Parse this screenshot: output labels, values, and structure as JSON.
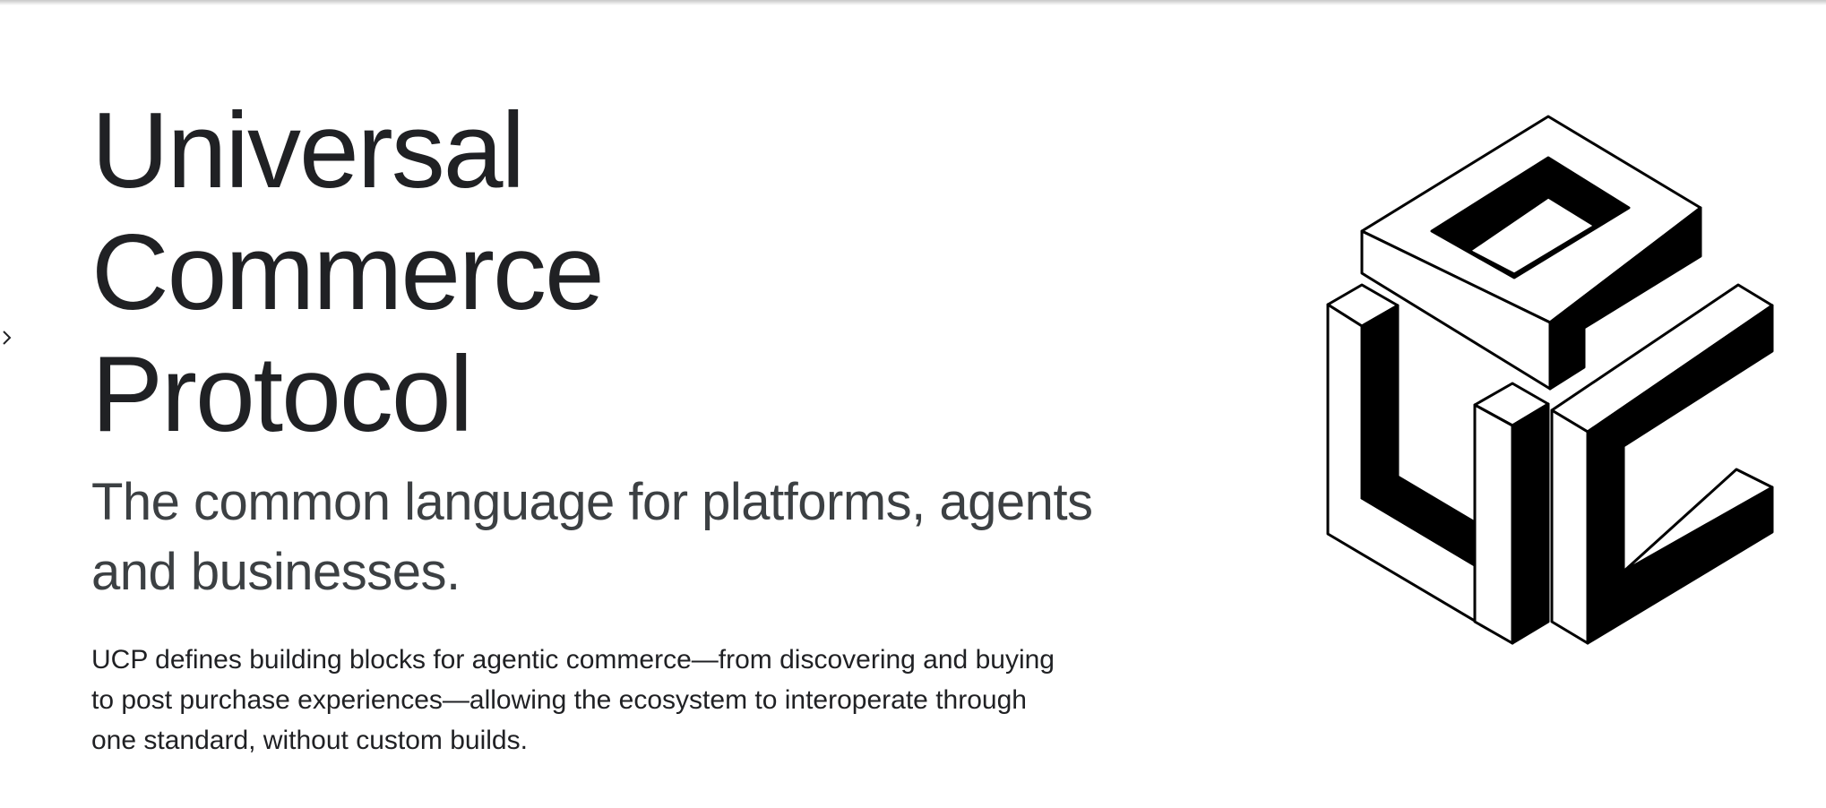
{
  "hero": {
    "title_lines": [
      "Universal",
      "Commerce",
      "Protocol"
    ],
    "subtitle": "The common language for platforms, agents and businesses.",
    "description": "UCP defines building blocks for agentic commerce—from discovering and buying to post purchase experiences—allowing the ecosystem to interoperate through one standard, without custom builds."
  },
  "icons": {
    "side_toggle": "chevron-right-icon",
    "logo": "ucp-isometric-logo"
  },
  "colors": {
    "text": "#202124",
    "subtitle": "#3c4043",
    "logo_fill": "#000000",
    "background": "#ffffff"
  }
}
